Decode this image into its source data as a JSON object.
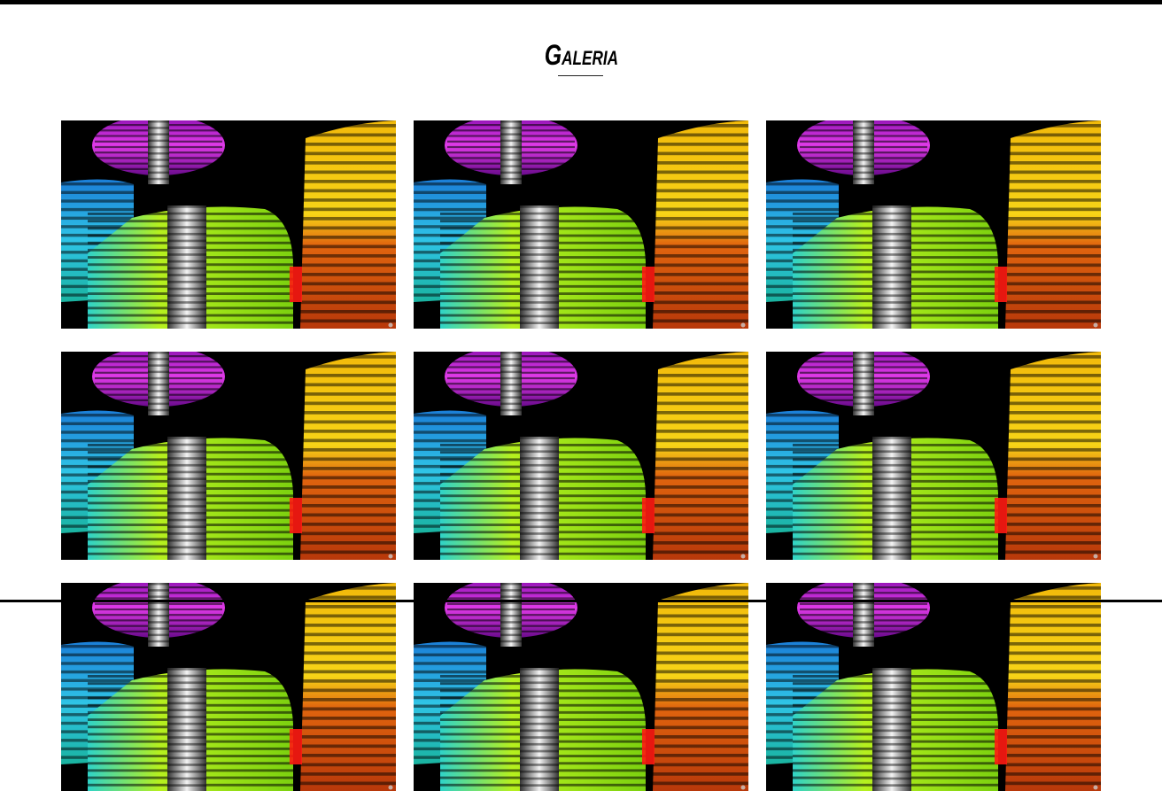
{
  "page": {
    "heading": "Galeria"
  },
  "colors": {
    "top_bar": "#000000",
    "background": "#ffffff",
    "accent_magenta": "#c21fd0",
    "accent_green": "#8fe11a",
    "accent_orange": "#f08a10",
    "accent_cyan": "#2bb7e0"
  },
  "gallery": {
    "tiles": [
      {
        "image": "light-trails-photo"
      },
      {
        "image": "light-trails-photo"
      },
      {
        "image": "light-trails-photo"
      },
      {
        "image": "light-trails-photo"
      },
      {
        "image": "light-trails-photo"
      },
      {
        "image": "light-trails-photo"
      },
      {
        "image": "light-trails-photo"
      },
      {
        "image": "light-trails-photo"
      },
      {
        "image": "light-trails-photo"
      }
    ]
  }
}
